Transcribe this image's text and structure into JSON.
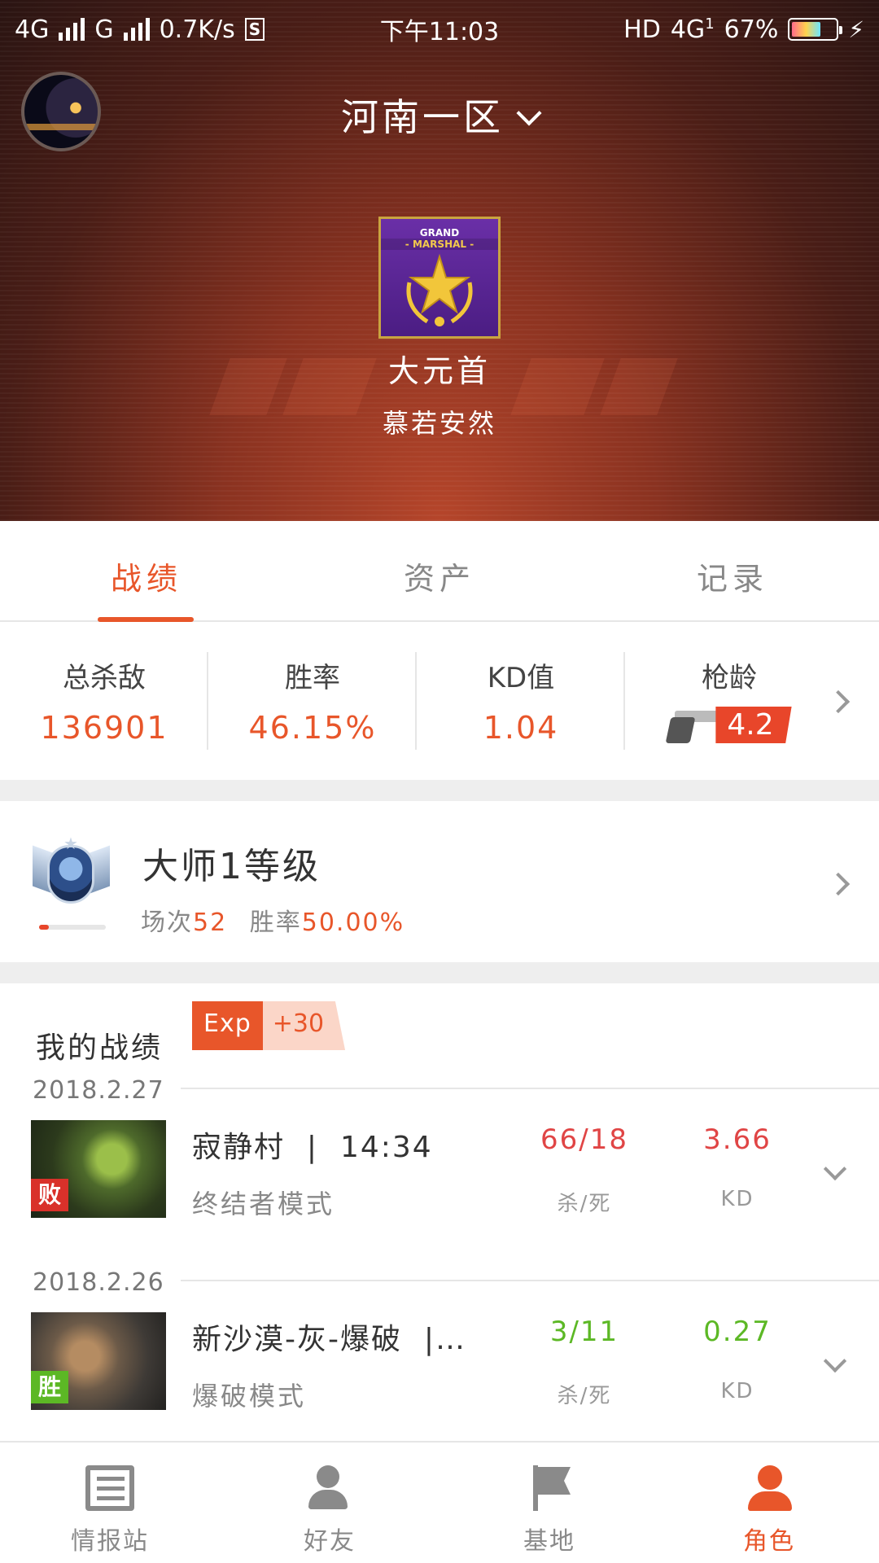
{
  "status_bar": {
    "network1": "4G",
    "network2": "G",
    "speed": "0.7K/s",
    "s_icon": "S",
    "time": "下午11:03",
    "hd": "HD",
    "net4g": "4G",
    "net_sub": "1",
    "battery_pct": "67%"
  },
  "header": {
    "server_name": "河南一区",
    "rank_badge_line1": "GRAND",
    "rank_badge_line2": "- MARSHAL -",
    "rank_name": "大元首",
    "player_name": "慕若安然"
  },
  "tabs": [
    "战绩",
    "资产",
    "记录"
  ],
  "active_tab": 0,
  "stats": [
    {
      "label": "总杀敌",
      "value": "136901"
    },
    {
      "label": "胜率",
      "value": "46.15%"
    },
    {
      "label": "KD值",
      "value": "1.04"
    },
    {
      "label": "枪龄",
      "value": "4.2"
    }
  ],
  "level": {
    "title": "大师1等级",
    "matches_label": "场次",
    "matches_value": "52",
    "winrate_label": "胜率",
    "winrate_value": "50.00%",
    "progress_fraction": 0.15
  },
  "record": {
    "heading": "我的战绩",
    "exp_key": "Exp",
    "exp_value": "+30",
    "matches": [
      {
        "date": "2018.2.27",
        "map": "寂静村",
        "sep": "|",
        "duration": "14:34",
        "mode": "终结者模式",
        "kd_ratio_text": "66/18",
        "kd_ratio_label": "杀/死",
        "kd_value": "3.66",
        "kd_label": "KD",
        "result": "败",
        "result_color": "#d9312a"
      },
      {
        "date": "2018.2.26",
        "map": "新沙漠-灰-爆破",
        "sep": "|…",
        "duration": "",
        "mode": "爆破模式",
        "kd_ratio_text": "3/11",
        "kd_ratio_label": "杀/死",
        "kd_value": "0.27",
        "kd_label": "KD",
        "result": "胜",
        "result_color": "#5cb825"
      }
    ]
  },
  "bottom_nav": [
    {
      "label": "情报站",
      "icon": "news-icon"
    },
    {
      "label": "好友",
      "icon": "friend-icon"
    },
    {
      "label": "基地",
      "icon": "flag-icon"
    },
    {
      "label": "角色",
      "icon": "role-icon"
    }
  ],
  "active_nav": 3,
  "colors": {
    "accent": "#e8562a",
    "loss": "#d9312a",
    "win": "#5cb825"
  }
}
